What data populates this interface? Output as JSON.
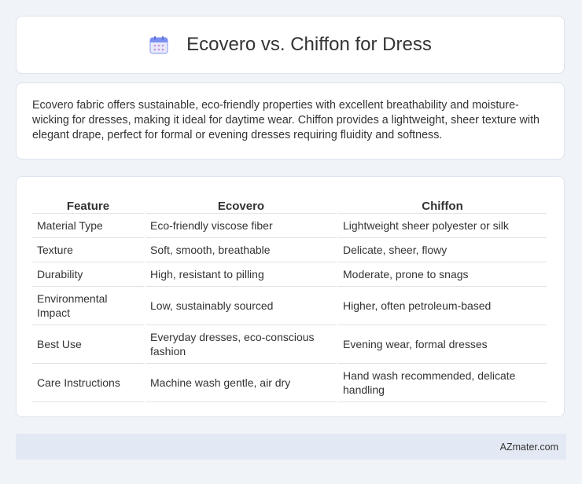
{
  "header": {
    "icon": "calendar-icon",
    "title": "Ecovero vs. Chiffon for Dress"
  },
  "intro": {
    "text": "Ecovero fabric offers sustainable, eco-friendly properties with excellent breathability and moisture-wicking for dresses, making it ideal for daytime wear. Chiffon provides a lightweight, sheer texture with elegant drape, perfect for formal or evening dresses requiring fluidity and softness."
  },
  "table": {
    "headers": [
      "Feature",
      "Ecovero",
      "Chiffon"
    ],
    "rows": [
      [
        "Material Type",
        "Eco-friendly viscose fiber",
        "Lightweight sheer polyester or silk"
      ],
      [
        "Texture",
        "Soft, smooth, breathable",
        "Delicate, sheer, flowy"
      ],
      [
        "Durability",
        "High, resistant to pilling",
        "Moderate, prone to snags"
      ],
      [
        "Environmental Impact",
        "Low, sustainably sourced",
        "Higher, often petroleum-based"
      ],
      [
        "Best Use",
        "Everyday dresses, eco-conscious fashion",
        "Evening wear, formal dresses"
      ],
      [
        "Care Instructions",
        "Machine wash gentle, air dry",
        "Hand wash recommended, delicate handling"
      ]
    ]
  },
  "footer": {
    "text": "AZmater.com"
  },
  "colors": {
    "background": "#f0f3f8",
    "card": "#ffffff",
    "footer_bg": "#e3e9f4",
    "icon_accent": "#7b8ff0"
  }
}
